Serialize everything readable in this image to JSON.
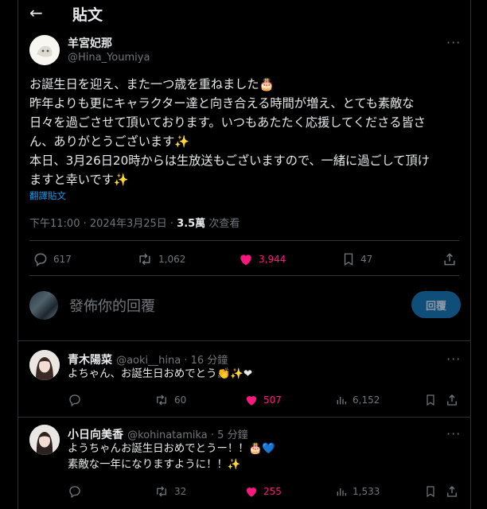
{
  "header": {
    "title": "貼文"
  },
  "post": {
    "author_name": "羊宮妃那",
    "author_handle": "@Hina_Youmiya",
    "lines": [
      "お誕生日を迎え、また一つ歳を重ねました🎂",
      "昨年よりも更にキャラクター達と向き合える時間が増え、とても素敵な",
      "日々を過ごさせて頂いております。いつもあたたく応援してくださる皆さ",
      "ん、ありがとうございます✨",
      "本日、3月26日20時からは生放送もございますので、一緒に過ごして頂け",
      "ますと幸いです✨"
    ],
    "translate": "翻譯貼文",
    "time": "下午11:00 · 2024年3月25日 · ",
    "views_count": "3.5萬",
    "views_label": " 次查看",
    "stats": {
      "replies": "617",
      "reposts": "1,062",
      "likes": "3,944",
      "bookmarks": "47"
    }
  },
  "reply_box": {
    "placeholder": "發佈你的回覆",
    "button": "回覆"
  },
  "comments": [
    {
      "name": "青木陽菜",
      "handle": "@aoki__hina",
      "time": " · 16 分鐘",
      "lines": [
        "よちゃん、お誕生日おめでとう👏✨❤"
      ],
      "reposts": "60",
      "likes": "507",
      "views": "6,152"
    },
    {
      "name": "小日向美香",
      "handle": "@kohinatamika",
      "time": " · 5 分鐘",
      "lines": [
        "ようちゃんお誕生日おめでとうー！！🎂💙",
        "素敵な一年になりますように！！✨"
      ],
      "reposts": "32",
      "likes": "255",
      "views": "1,533"
    }
  ],
  "colors": {
    "like": "#f91880",
    "link": "#1d9bf0",
    "muted": "#71767b"
  }
}
